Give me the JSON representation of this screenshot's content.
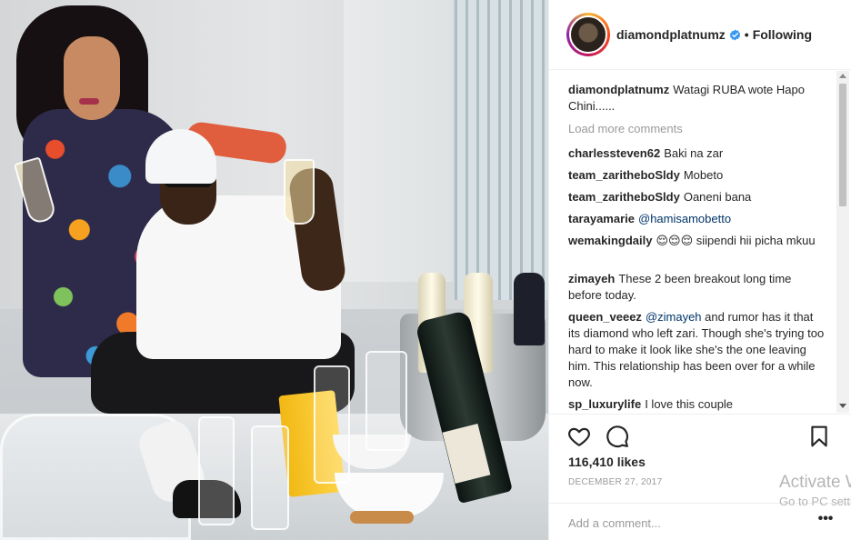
{
  "post": {
    "username": "diamondplatnumz",
    "follow_state": "Following",
    "separator": "•",
    "caption": {
      "user": "diamondplatnumz",
      "text": "Watagi RUBA wote Hapo Chini......"
    },
    "load_more_label": "Load more comments",
    "comments": [
      {
        "user": "charlessteven62",
        "text": "Baki na zar"
      },
      {
        "user": "team_zaritheboSldy",
        "text": "Mobeto"
      },
      {
        "user": "team_zaritheboSldy",
        "text": "Oaneni bana"
      },
      {
        "user": "tarayamarie",
        "mention": "@hamisamobetto",
        "text": ""
      },
      {
        "user": "wemakingdaily",
        "text": "😌😌😌 siipendi hii picha mkuu"
      },
      {
        "user": "zimayeh",
        "text": "These 2 been breakout long time before today."
      },
      {
        "user": "queen_veeez",
        "mention": "@zimayeh",
        "text": "and rumor has it that its diamond who left zari. Though she's trying too hard to make it look like she's the one leaving him. This relationship has been over for a while now."
      },
      {
        "user": "sp_luxurylife",
        "text": "I love this couple"
      }
    ],
    "likes": "116,410 likes",
    "date": "DECEMBER 27, 2017",
    "add_comment_placeholder": "Add a comment...",
    "more_glyph": "•••"
  },
  "icons": {
    "like": "heart-icon",
    "comment": "comment-bubble-icon",
    "save": "bookmark-icon",
    "verified": "verified-badge-icon",
    "more": "more-options-icon"
  },
  "colors": {
    "verified_blue": "#3897f0",
    "text": "#262626",
    "muted": "#999999",
    "mention": "#003569",
    "divider": "#efefef"
  },
  "watermark": {
    "line1": "Activate Windows",
    "line2": "Go to PC settings"
  }
}
